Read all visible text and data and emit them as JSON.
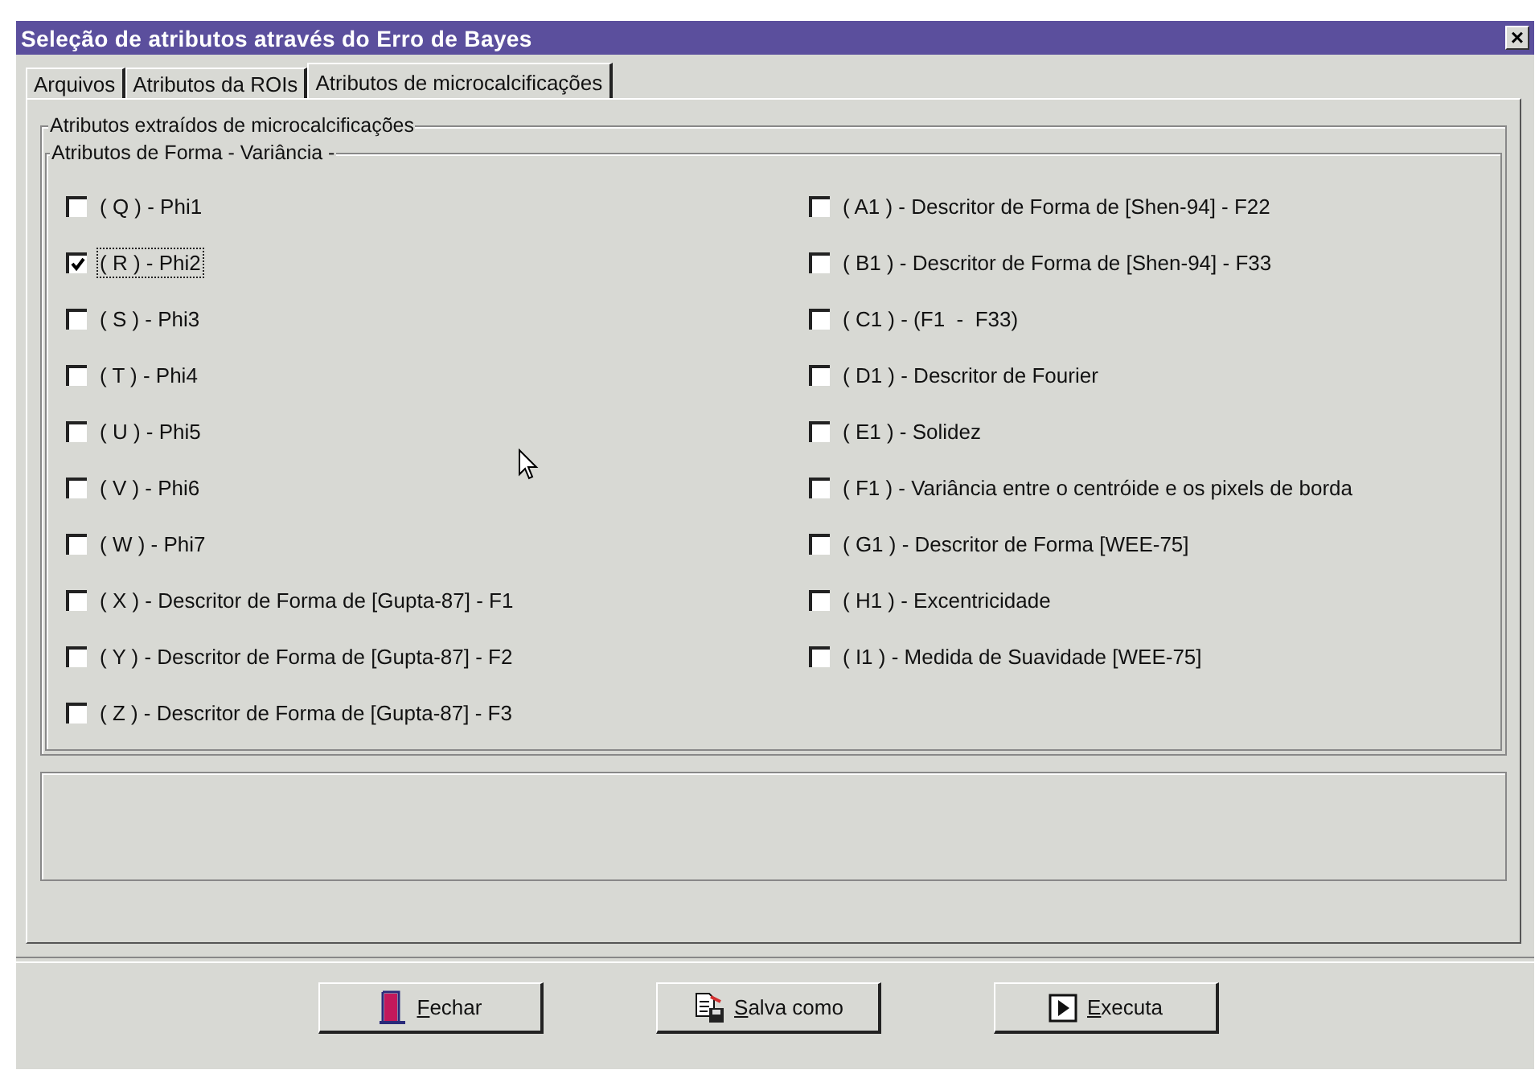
{
  "window": {
    "title": "Seleção de atributos através do Erro de Bayes",
    "close": "×"
  },
  "tabs": [
    {
      "label": "Arquivos",
      "selected": false
    },
    {
      "label": "Atributos da ROIs",
      "selected": false
    },
    {
      "label": "Atributos de microcalcificações",
      "selected": true
    }
  ],
  "outer_group": {
    "title": "Atributos extraídos de microcalcificações"
  },
  "inner_group": {
    "title": "Atributos de Forma - Variância -"
  },
  "columns": [
    [
      {
        "label": "( Q ) - Phi1",
        "checked": false,
        "focused": false
      },
      {
        "label": "( R ) - Phi2",
        "checked": true,
        "focused": true
      },
      {
        "label": "( S ) - Phi3",
        "checked": false,
        "focused": false
      },
      {
        "label": "( T ) - Phi4",
        "checked": false,
        "focused": false
      },
      {
        "label": "( U ) - Phi5",
        "checked": false,
        "focused": false
      },
      {
        "label": "( V ) - Phi6",
        "checked": false,
        "focused": false
      },
      {
        "label": "( W ) - Phi7",
        "checked": false,
        "focused": false
      },
      {
        "label": "( X ) - Descritor de Forma de [Gupta-87] - F1",
        "checked": false,
        "focused": false
      },
      {
        "label": "( Y ) - Descritor de Forma de [Gupta-87] - F2",
        "checked": false,
        "focused": false
      },
      {
        "label": "( Z ) - Descritor de Forma de [Gupta-87] - F3",
        "checked": false,
        "focused": false
      }
    ],
    [
      {
        "label": "( A1 ) - Descritor de Forma de [Shen-94] - F22",
        "checked": false,
        "focused": false
      },
      {
        "label": "( B1 ) - Descritor de Forma de [Shen-94] - F33",
        "checked": false,
        "focused": false
      },
      {
        "label": "( C1 ) - (F1  -  F33)",
        "checked": false,
        "focused": false
      },
      {
        "label": "( D1 ) - Descritor de Fourier",
        "checked": false,
        "focused": false
      },
      {
        "label": "( E1 ) - Solidez",
        "checked": false,
        "focused": false
      },
      {
        "label": "( F1 ) - Variância entre o centróide e os pixels de borda",
        "checked": false,
        "focused": false
      },
      {
        "label": "( G1 ) - Descritor de Forma [WEE-75]",
        "checked": false,
        "focused": false
      },
      {
        "label": "( H1 ) - Excentricidade",
        "checked": false,
        "focused": false
      },
      {
        "label": "( I1 ) - Medida de Suavidade [WEE-75]",
        "checked": false,
        "focused": false
      }
    ]
  ],
  "buttons": [
    {
      "label": "Fechar",
      "kind": "close"
    },
    {
      "label": "Salva como",
      "kind": "save"
    },
    {
      "label": "Executa",
      "kind": "run"
    }
  ]
}
